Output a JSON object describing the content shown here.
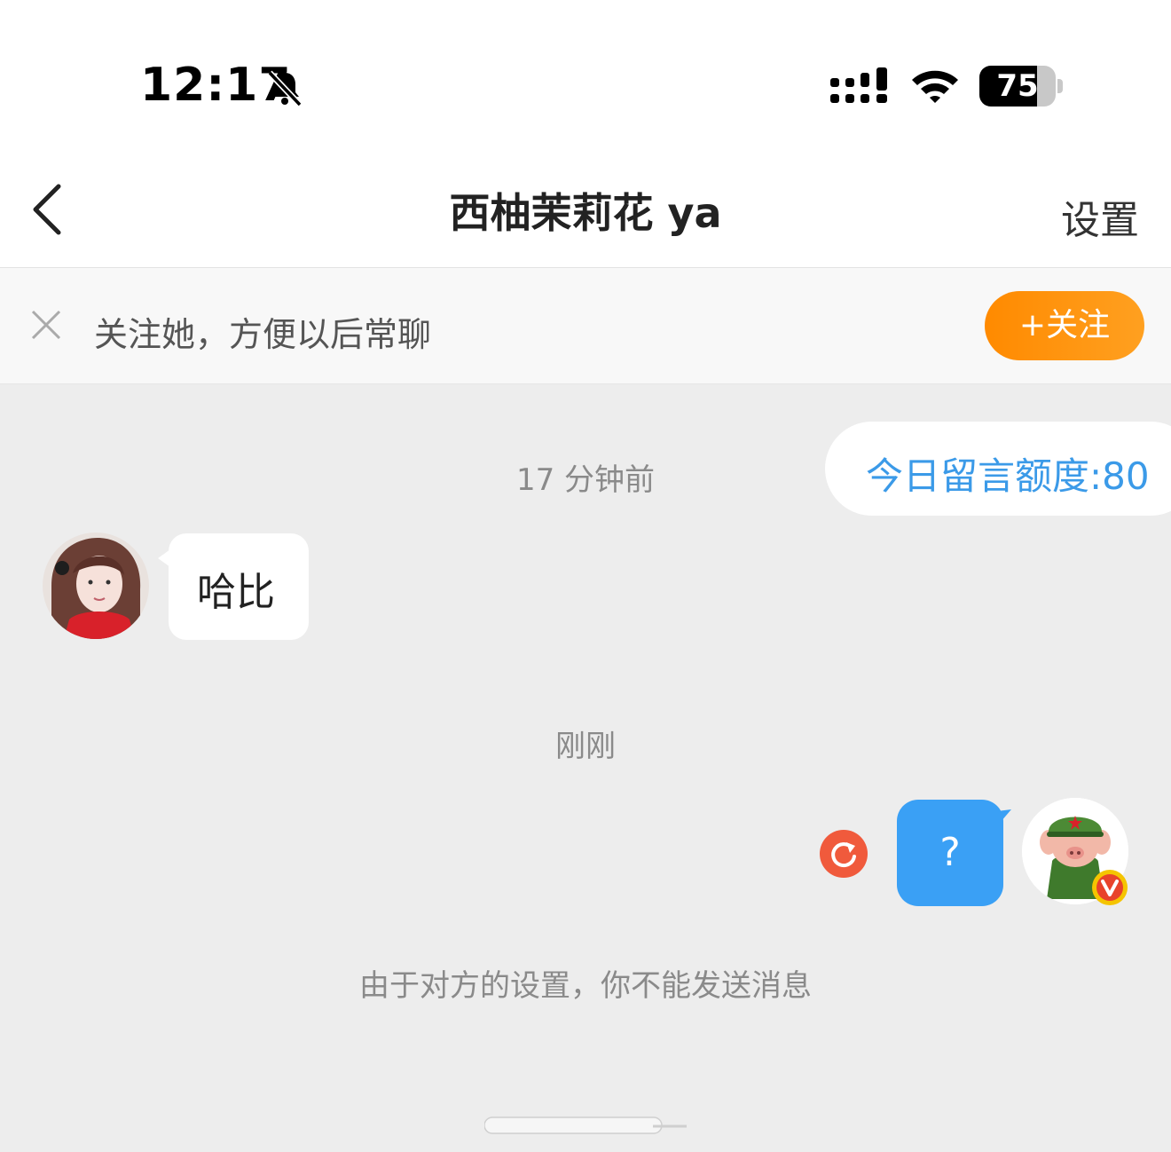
{
  "status_bar": {
    "time": "12:17",
    "battery": "75",
    "battery_level": 0.75,
    "icons": [
      "bell-off-icon",
      "signal-icon",
      "wifi-icon",
      "battery-icon"
    ]
  },
  "nav": {
    "title": "西柚茉莉花 ya",
    "settings_label": "设置",
    "back_icon": "chevron-left-icon"
  },
  "follow_bar": {
    "text": "关注她，方便以后常聊",
    "button_label": "+关注",
    "close_icon": "close-icon"
  },
  "chat": {
    "quota_text": "今日留言额度:80",
    "messages": [
      {
        "time": "17 分钟前",
        "side": "left",
        "text": "哈比"
      },
      {
        "time": "刚刚",
        "side": "right",
        "text": "?"
      }
    ],
    "system_note": "由于对方的设置，你不能发送消息"
  },
  "colors": {
    "accent_orange": "#ff8a00",
    "bubble_blue": "#3aa0f5",
    "quota_blue": "#3b9ae8",
    "resend_red": "#f05a3c",
    "badge_yellow": "#f5c400"
  }
}
